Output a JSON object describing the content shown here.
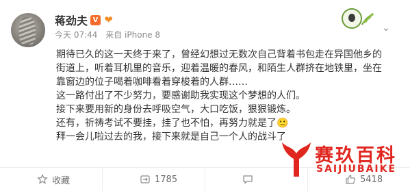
{
  "post": {
    "author": "蒋劲夫",
    "timestamp": "今天 07:44",
    "source": "来自 iPhone 8",
    "paragraphs": [
      "期待已久的这一天终于来了，曾经幻想过无数次自己背着书包走在异国他乡的街道上，听着耳机里的音乐，迎着温暖的春风，和陌生人群挤在地铁里，坐在靠窗边的位子喝着咖啡看着穿梭着的人群……",
      "这一路付出了不少努力，要感谢助我实现这个梦想的人们。",
      "接下来要用新的身份去呼吸空气，大口吃饭，狠狠锻炼。",
      "还有，祈祷考试不要挂，挂了也不怕，再努力就是了🙂",
      "拜一会儿啦过去的我，接下来就是自己一个人的战斗了"
    ]
  },
  "actions": {
    "favorite_label": "收藏",
    "repost_count": "1785",
    "comment_count": "",
    "like_count": "5418"
  },
  "watermark": {
    "title": "赛玖百科",
    "subtitle": "SAIJIUBAIKE"
  },
  "colors": {
    "accent": "#f28d27",
    "watermark": "#e0271f",
    "vip_badge": "#f56b2a"
  },
  "icons": {
    "menu": "chevron-down-icon",
    "favorite": "star-icon",
    "repost": "repost-icon",
    "comment": "comment-icon",
    "like": "thumbs-up-icon"
  }
}
